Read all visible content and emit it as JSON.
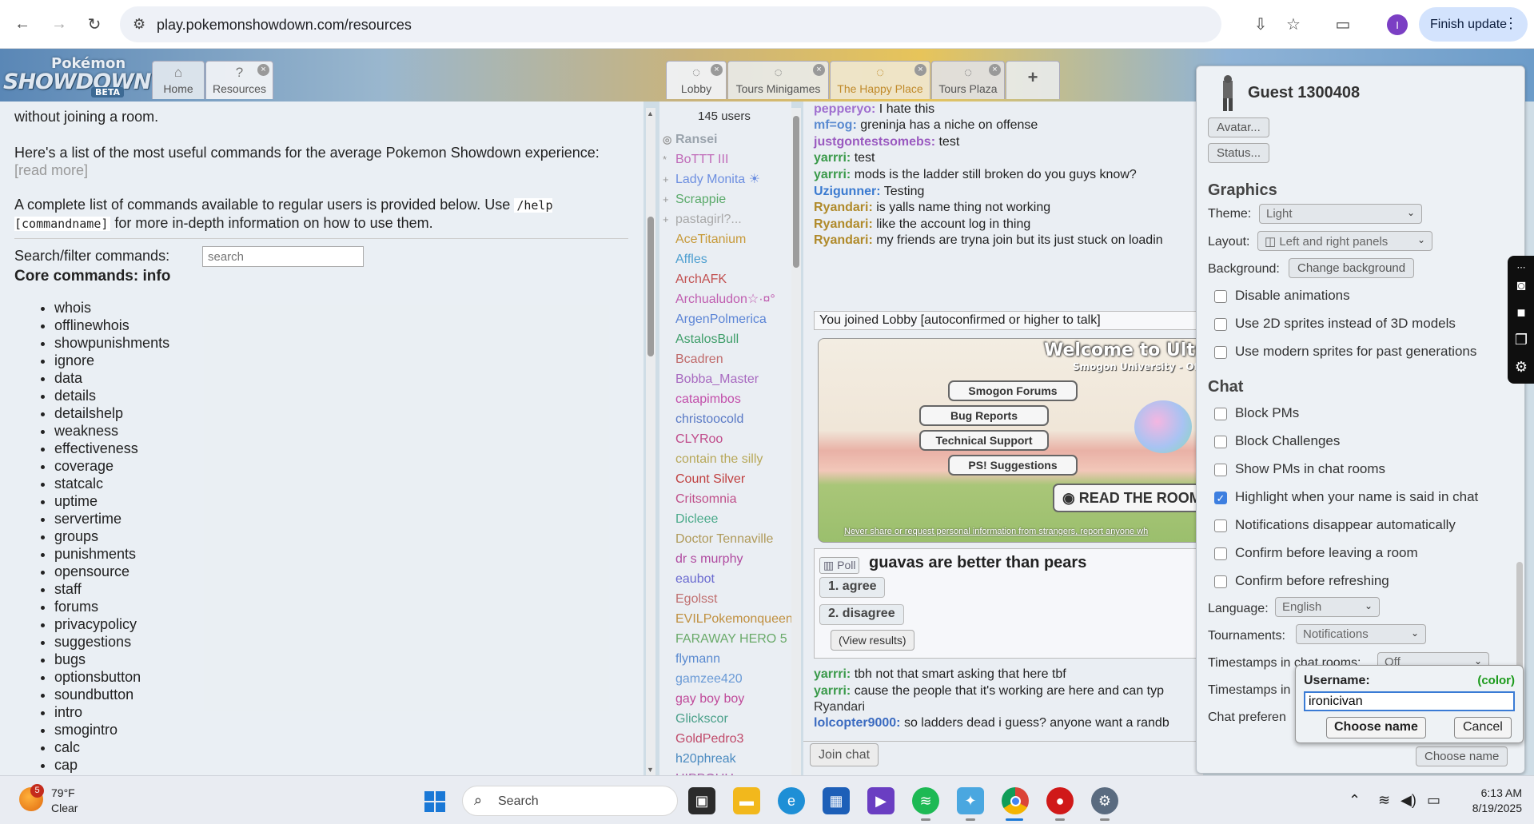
{
  "browser": {
    "url": "play.pokemonshowdown.com/resources",
    "profile_initial": "I",
    "finish_update": "Finish update"
  },
  "header": {
    "logo": {
      "top": "Pokémon",
      "main": "SHOWDOWN",
      "badge": "BETA"
    },
    "left_tabs": [
      {
        "label": "Home",
        "icon": "home-icon"
      },
      {
        "label": "Resources",
        "icon": "question-icon"
      }
    ],
    "room_tabs": [
      {
        "label": "Lobby"
      },
      {
        "label": "Tours Minigames"
      },
      {
        "label": "The Happy Place"
      },
      {
        "label": "Tours Plaza"
      }
    ],
    "new_tab": "+"
  },
  "help": {
    "intro_tail": "without joining a room.",
    "para1": "Here's a list of the most useful commands for the average Pokemon Showdown experience:",
    "read_more": "[read more]",
    "para2_a": "A complete list of commands available to regular users is provided below. Use",
    "para2_code": "/help [commandname]",
    "para2_b": "for more in-depth information on how to use them.",
    "search_label": "Search/filter commands:",
    "search_placeholder": "search",
    "core_title": "Core commands: info",
    "commands": [
      "whois",
      "offlinewhois",
      "showpunishments",
      "ignore",
      "data",
      "details",
      "detailshelp",
      "weakness",
      "effectiveness",
      "coverage",
      "statcalc",
      "uptime",
      "servertime",
      "groups",
      "punishments",
      "opensource",
      "staff",
      "forums",
      "privacypolicy",
      "suggestions",
      "bugs",
      "optionsbutton",
      "soundbutton",
      "intro",
      "smogintro",
      "calc",
      "cap"
    ]
  },
  "userlist": {
    "count": "145 users",
    "users": [
      {
        "name": "Ransei",
        "color": "#9aa3ac",
        "rank": "◎",
        "bold": true
      },
      {
        "name": "BoTTT III",
        "color": "#c06ab8",
        "rank": "*"
      },
      {
        "name": "Lady Monita ☀",
        "color": "#6d8fe0",
        "rank": "+"
      },
      {
        "name": "Scrappie",
        "color": "#5aaa6a",
        "rank": "+"
      },
      {
        "name": "pastagirl?...",
        "color": "#a9a9a9",
        "rank": "+"
      },
      {
        "name": "AceTitanium",
        "color": "#c79a3a",
        "rank": ""
      },
      {
        "name": "Affles",
        "color": "#4e9fd0",
        "rank": ""
      },
      {
        "name": "ArchAFK",
        "color": "#c25050",
        "rank": ""
      },
      {
        "name": "Archualudon☆·¤°",
        "color": "#c05eb0",
        "rank": ""
      },
      {
        "name": "ArgenPolmerica",
        "color": "#5c85d6",
        "rank": ""
      },
      {
        "name": "AstalosBull",
        "color": "#3f9e6a",
        "rank": ""
      },
      {
        "name": "Bcadren",
        "color": "#c06a6a",
        "rank": ""
      },
      {
        "name": "Bobba_Master",
        "color": "#a86ac0",
        "rank": ""
      },
      {
        "name": "catapimbos",
        "color": "#c24eaa",
        "rank": ""
      },
      {
        "name": "christoocold",
        "color": "#5a7ac6",
        "rank": ""
      },
      {
        "name": "CLYRoo",
        "color": "#c04a8a",
        "rank": ""
      },
      {
        "name": "contain the silly",
        "color": "#b8a85a",
        "rank": ""
      },
      {
        "name": "Count Silver",
        "color": "#c04040",
        "rank": ""
      },
      {
        "name": "Critsomnia",
        "color": "#c0508a",
        "rank": ""
      },
      {
        "name": "Dicleee",
        "color": "#4aaa8a",
        "rank": ""
      },
      {
        "name": "Doctor Tennaville",
        "color": "#b09a5a",
        "rank": ""
      },
      {
        "name": "dr s murphy",
        "color": "#b04aa0",
        "rank": ""
      },
      {
        "name": "eaubot",
        "color": "#6a6ad0",
        "rank": ""
      },
      {
        "name": "Egolsst",
        "color": "#c07070",
        "rank": ""
      },
      {
        "name": "EVILPokemonqueen",
        "color": "#c09040",
        "rank": ""
      },
      {
        "name": "FARAWAY HERO 5",
        "color": "#6aaa6a",
        "rank": ""
      },
      {
        "name": "flymann",
        "color": "#5a8ad0",
        "rank": ""
      },
      {
        "name": "gamzee420",
        "color": "#6a9ad6",
        "rank": ""
      },
      {
        "name": "gay boy boy",
        "color": "#c04a9a",
        "rank": ""
      },
      {
        "name": "Glickscor",
        "color": "#4aa08a",
        "rank": ""
      },
      {
        "name": "GoldPedro3",
        "color": "#c04a6a",
        "rank": ""
      },
      {
        "name": "h20phreak",
        "color": "#4a8ac0",
        "rank": ""
      },
      {
        "name": "HIPPOUH",
        "color": "#aa5aaa",
        "rank": ""
      }
    ]
  },
  "chat": {
    "messages_top": [
      {
        "user": "pepperyo:",
        "color": "#a070d0",
        "text": "",
        "link": "https://replay.pokemonshowdown.com/gen9monot"
      },
      {
        "user": "pepperyo:",
        "color": "#a070d0",
        "text": "I hate this"
      },
      {
        "user": "mf=og:",
        "color": "#5a8ad0",
        "text": "greninja has a niche on offense"
      },
      {
        "user": "justgontestsomebs:",
        "color": "#9a5ac0",
        "text": "test"
      },
      {
        "user": "yarrri:",
        "color": "#3a9a4a",
        "text": "test"
      },
      {
        "user": "yarrri:",
        "color": "#3a9a4a",
        "text": "mods is the ladder still broken do you guys know?"
      },
      {
        "user": "Uzigunner:",
        "color": "#3a7ad0",
        "text": "Testing"
      },
      {
        "user": "Ryandari:",
        "color": "#b08a2a",
        "text": "is yalls name thing not working"
      },
      {
        "user": "Ryandari:",
        "color": "#b08a2a",
        "text": "like the account log in thing"
      },
      {
        "user": "Ryandari:",
        "color": "#b08a2a",
        "text": "my friends are tryna join but its just stuck on loadin"
      }
    ],
    "joined": "You joined Lobby [autoconfirmed or higher to talk]",
    "welcome": {
      "title": "Welcome to Ultra-G",
      "subtitle": "Smogon University - Offi",
      "buttons": [
        "Smogon Forums",
        "Bug Reports",
        "Technical Support",
        "PS! Suggestions"
      ],
      "read_room": "◉ READ THE ROOM",
      "warning": "Never share or request personal information from strangers, report anyone wh"
    },
    "poll": {
      "tag": "Poll",
      "question": "guavas are better than pears",
      "options": [
        "1. agree",
        "2. disagree"
      ],
      "view_results": "(View results)"
    },
    "messages_bottom": [
      {
        "user": "yarrri:",
        "color": "#3a9a4a",
        "text": "tbh not that smart asking that here tbf"
      },
      {
        "user": "yarrri:",
        "color": "#3a9a4a",
        "text": "cause the people that it's working are here and can typ",
        "cont": "Ryandari"
      },
      {
        "user": "lolcopter9000:",
        "color": "#3a6ac0",
        "text": "so ladders dead i guess? anyone want a randb"
      }
    ],
    "join_chat": "Join chat"
  },
  "options": {
    "guest_name": "Guest 1300408",
    "avatar_btn": "Avatar...",
    "status_btn": "Status...",
    "graphics_title": "Graphics",
    "theme_label": "Theme:",
    "theme_value": "Light",
    "layout_label": "Layout:",
    "layout_value": "◫ Left and right panels",
    "background_label": "Background:",
    "background_btn": "Change background",
    "graphics_checks": [
      {
        "label": "Disable animations",
        "checked": false
      },
      {
        "label": "Use 2D sprites instead of 3D models",
        "checked": false
      },
      {
        "label": "Use modern sprites for past generations",
        "checked": false
      }
    ],
    "chat_title": "Chat",
    "chat_checks": [
      {
        "label": "Block PMs",
        "checked": false
      },
      {
        "label": "Block Challenges",
        "checked": false
      },
      {
        "label": "Show PMs in chat rooms",
        "checked": false
      },
      {
        "label": "Highlight when your name is said in chat",
        "checked": true
      },
      {
        "label": "Notifications disappear automatically",
        "checked": false
      },
      {
        "label": "Confirm before leaving a room",
        "checked": false
      },
      {
        "label": "Confirm before refreshing",
        "checked": false
      }
    ],
    "language_label": "Language:",
    "language_value": "English",
    "tournaments_label": "Tournaments:",
    "tournaments_value": "Notifications",
    "ts_rooms_label": "Timestamps in chat rooms:",
    "ts_rooms_value": "Off",
    "ts_pms_label": "Timestamps in",
    "chat_pref_label": "Chat preferen",
    "choose_name_bottom": "Choose name"
  },
  "name_dialog": {
    "label": "Username:",
    "color_link": "(color)",
    "value": "ironicivan",
    "choose": "Choose name",
    "cancel": "Cancel"
  },
  "taskbar": {
    "weather_badge": "5",
    "temp": "79°F",
    "condition": "Clear",
    "search": "Search",
    "time": "6:13 AM",
    "date": "8/19/2025"
  }
}
